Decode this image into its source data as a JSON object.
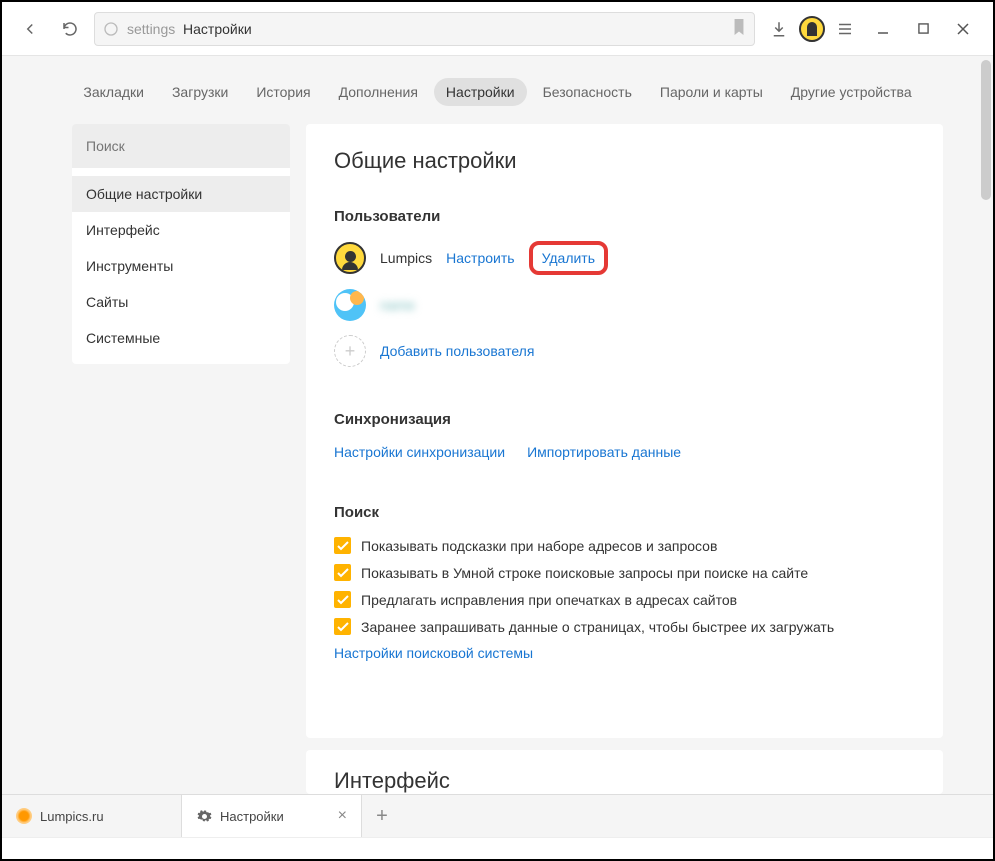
{
  "toolbar": {
    "address_proto": "settings",
    "address_title": "Настройки"
  },
  "nav": {
    "tabs": [
      {
        "label": "Закладки"
      },
      {
        "label": "Загрузки"
      },
      {
        "label": "История"
      },
      {
        "label": "Дополнения"
      },
      {
        "label": "Настройки",
        "active": true
      },
      {
        "label": "Безопасность"
      },
      {
        "label": "Пароли и карты"
      },
      {
        "label": "Другие устройства"
      }
    ]
  },
  "sidebar": {
    "search_placeholder": "Поиск",
    "items": [
      {
        "label": "Общие настройки",
        "active": true
      },
      {
        "label": "Интерфейс"
      },
      {
        "label": "Инструменты"
      },
      {
        "label": "Сайты"
      },
      {
        "label": "Системные"
      }
    ]
  },
  "panel": {
    "title": "Общие настройки",
    "users": {
      "title": "Пользователи",
      "list": [
        {
          "name": "Lumpics",
          "configure": "Настроить",
          "delete": "Удалить"
        },
        {
          "name": "blurred"
        }
      ],
      "add_label": "Добавить пользователя"
    },
    "sync": {
      "title": "Синхронизация",
      "settings_link": "Настройки синхронизации",
      "import_link": "Импортировать данные"
    },
    "search": {
      "title": "Поиск",
      "opts": [
        "Показывать подсказки при наборе адресов и запросов",
        "Показывать в Умной строке поисковые запросы при поиске на сайте",
        "Предлагать исправления при опечатках в адресах сайтов",
        "Заранее запрашивать данные о страницах, чтобы быстрее их загружать"
      ],
      "engine_link": "Настройки поисковой системы"
    },
    "next_title": "Интерфейс"
  },
  "bottom_tabs": {
    "tabs": [
      {
        "label": "Lumpics.ru"
      },
      {
        "label": "Настройки",
        "active": true
      }
    ]
  }
}
